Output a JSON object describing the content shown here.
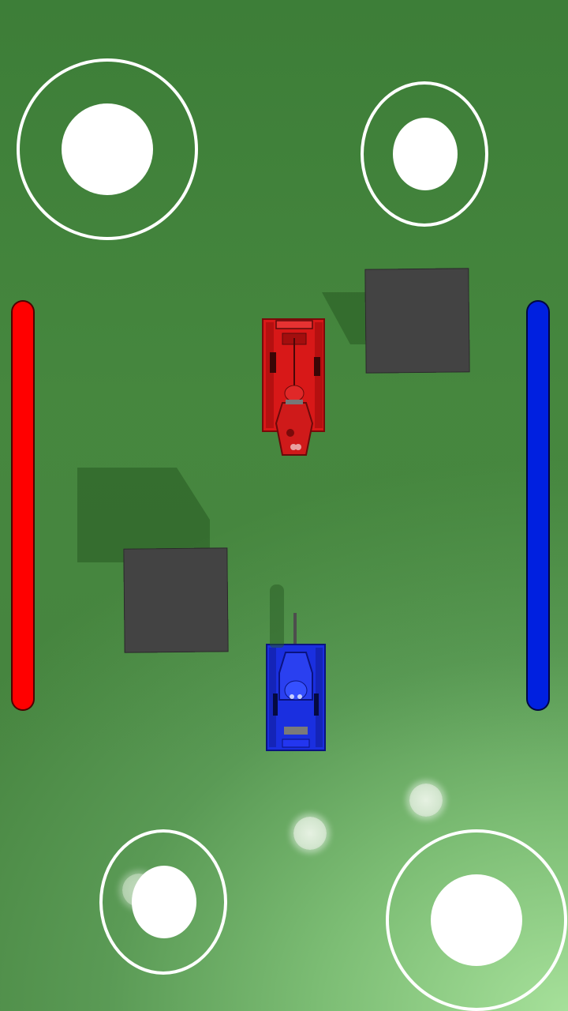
{
  "game": {
    "colors": {
      "ground": "#4f8f4a",
      "obstacle": "#434343",
      "red_team": "#ff0000",
      "blue_team": "#0020e0",
      "control": "#ffffff"
    },
    "health": {
      "red_percent": 100,
      "blue_percent": 100
    },
    "tanks": [
      {
        "team": "red",
        "facing": "down"
      },
      {
        "team": "blue",
        "facing": "up"
      }
    ],
    "obstacles_count": 2,
    "pickups_count": 3,
    "controls": [
      {
        "owner": "red",
        "role": "move-joystick"
      },
      {
        "owner": "red",
        "role": "aim-joystick"
      },
      {
        "owner": "blue",
        "role": "aim-joystick"
      },
      {
        "owner": "blue",
        "role": "move-joystick"
      }
    ]
  }
}
